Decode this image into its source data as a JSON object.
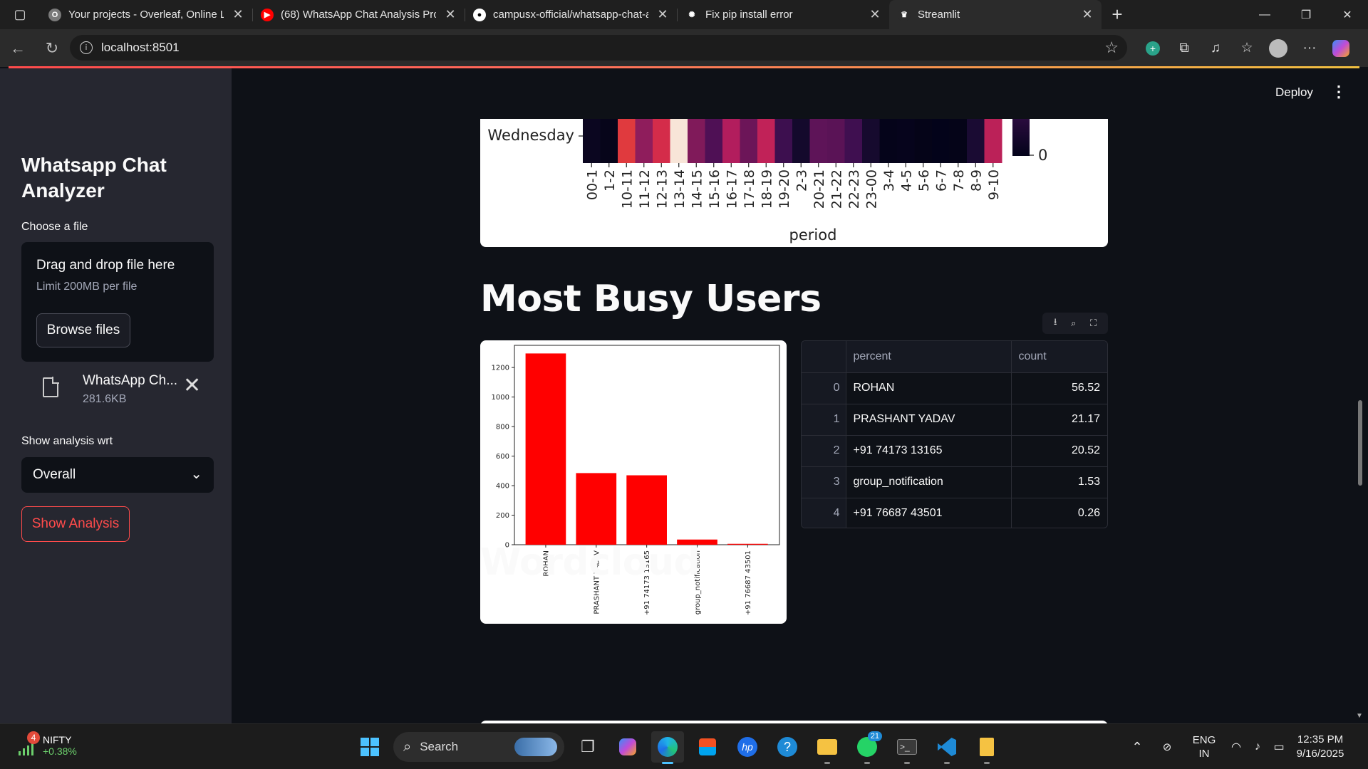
{
  "browser": {
    "tabs": [
      {
        "title": "Your projects - Overleaf, Online La",
        "fav": "O",
        "fav_color": "#7a7a7a"
      },
      {
        "title": "(68) WhatsApp Chat Analysis Proj",
        "fav": "▶",
        "fav_color": "#ff0000"
      },
      {
        "title": "campusx-official/whatsapp-chat-a",
        "fav": "●",
        "fav_color": "#ffffff"
      },
      {
        "title": "Fix pip install error",
        "fav": "✺",
        "fav_color": "#1f1f1f"
      },
      {
        "title": "Streamlit",
        "fav": "♛",
        "fav_color": "#2b2b2b"
      }
    ],
    "url": "localhost:8501"
  },
  "sidebar": {
    "title": "Whatsapp Chat Analyzer",
    "upload_label": "Choose a file",
    "dropzone_text": "Drag and drop file here",
    "dropzone_limit": "Limit 200MB per file",
    "browse_label": "Browse files",
    "file_name": "WhatsApp Ch...",
    "file_size": "281.6KB",
    "select_label": "Show analysis wrt",
    "select_value": "Overall",
    "show_button": "Show Analysis"
  },
  "header": {
    "deploy": "Deploy"
  },
  "heatmap": {
    "row_label": "Wednesday",
    "xlabel": "period",
    "periods": [
      "00-1",
      "1-2",
      "10-11",
      "11-12",
      "12-13",
      "13-14",
      "14-15",
      "15-16",
      "16-17",
      "17-18",
      "18-19",
      "19-20",
      "2-3",
      "20-21",
      "21-22",
      "22-23",
      "23-00",
      "3-4",
      "4-5",
      "5-6",
      "6-7",
      "7-8",
      "8-9",
      "9-10"
    ],
    "colors": [
      "#0b0620",
      "#07051a",
      "#e03a3e",
      "#8f1d5c",
      "#d42c4a",
      "#f8e5d8",
      "#801a5a",
      "#4f1055",
      "#b21d5d",
      "#6c1558",
      "#c12258",
      "#3d0f4f",
      "#14092c",
      "#5e1458",
      "#5a1356",
      "#3f0f50",
      "#160a2e",
      "#05041a",
      "#06041c",
      "#050418",
      "#03031a",
      "#050418",
      "#1a0b33",
      "#bb2158"
    ],
    "colorbar_tick": "0"
  },
  "busy_users": {
    "heading": "Most Busy Users",
    "table_headers": [
      "",
      "percent",
      "count"
    ],
    "rows": [
      {
        "index": "0",
        "name": "ROHAN",
        "value": "56.52"
      },
      {
        "index": "1",
        "name": "PRASHANT YADAV",
        "value": "21.17"
      },
      {
        "index": "2",
        "name": "+91 74173 13165",
        "value": "20.52"
      },
      {
        "index": "3",
        "name": "group_notification",
        "value": "1.53"
      },
      {
        "index": "4",
        "name": "+91 76687 43501",
        "value": "0.26"
      }
    ]
  },
  "chart_data": {
    "type": "bar",
    "categories": [
      "ROHAN",
      "PRASHANT YADAV",
      "+91 74173 13165",
      "group_notification",
      "+91 76687 43501"
    ],
    "values": [
      1295,
      485,
      470,
      35,
      6
    ],
    "ylim": [
      0,
      1350
    ],
    "yticks": [
      0,
      200,
      400,
      600,
      800,
      1000,
      1200
    ],
    "bar_color": "#ff0000"
  },
  "wordcloud": {
    "heading": "Wordcloud"
  },
  "taskbar": {
    "nifty_name": "NIFTY",
    "nifty_change": "+0.38%",
    "nifty_badge": "4",
    "search_label": "Search",
    "whatsapp_badge": "21",
    "lang_1": "ENG",
    "lang_2": "IN",
    "time": "12:35 PM",
    "date": "9/16/2025"
  }
}
